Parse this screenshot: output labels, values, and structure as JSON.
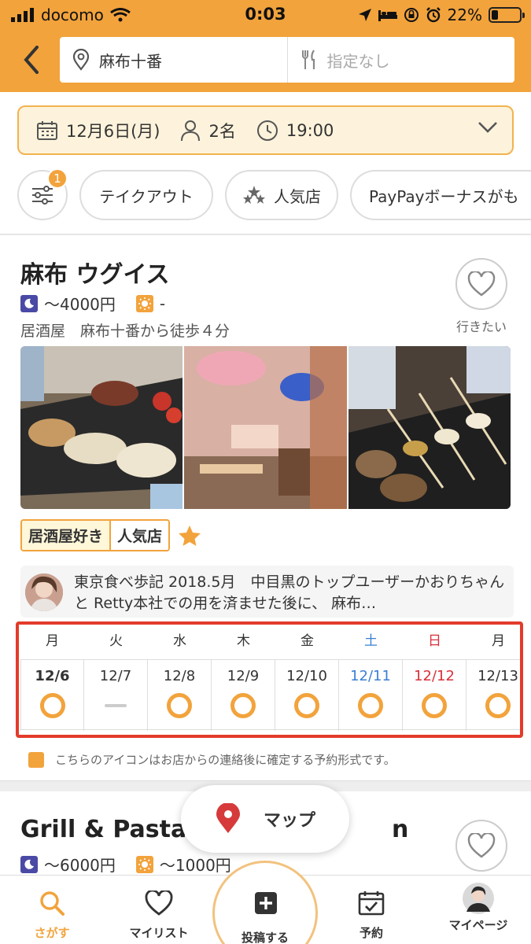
{
  "status_bar": {
    "carrier": "docomo",
    "time": "0:03",
    "battery": "22%"
  },
  "header": {
    "location": "麻布十番",
    "genre_placeholder": "指定なし"
  },
  "conditions": {
    "date": "12月6日(月)",
    "people": "2名",
    "time": "19:00"
  },
  "filter_chips": {
    "filter_badge": "1",
    "items": [
      {
        "label": "テイクアウト"
      },
      {
        "label": "人気店"
      },
      {
        "label": "PayPayボーナスがも"
      }
    ]
  },
  "restaurant1": {
    "name": "麻布 ウグイス",
    "dinner_price": "～4000円",
    "lunch_price": "-",
    "genre_access": "居酒屋　麻布十番から徒歩４分",
    "like_label": "行きたい",
    "tags": [
      "居酒屋好き",
      "人気店"
    ],
    "review": "東京食べ歩記 2018.5月　中目黒のトップユーザーかおりちゃんと Retty本社での用を済ませた後に、 麻布…"
  },
  "calendar": {
    "days": [
      {
        "dow": "月",
        "date": "12/6",
        "status": "available",
        "kind": "weekday",
        "selected": true
      },
      {
        "dow": "火",
        "date": "12/7",
        "status": "unavailable",
        "kind": "weekday"
      },
      {
        "dow": "水",
        "date": "12/8",
        "status": "available",
        "kind": "weekday"
      },
      {
        "dow": "木",
        "date": "12/9",
        "status": "available",
        "kind": "weekday"
      },
      {
        "dow": "金",
        "date": "12/10",
        "status": "available",
        "kind": "weekday"
      },
      {
        "dow": "土",
        "date": "12/11",
        "status": "available",
        "kind": "saturday"
      },
      {
        "dow": "日",
        "date": "12/12",
        "status": "available",
        "kind": "sunday"
      },
      {
        "dow": "月",
        "date": "12/13",
        "status": "available",
        "kind": "weekday"
      }
    ],
    "note": "こちらのアイコンはお店からの連絡後に確定する予約形式です。"
  },
  "restaurant2": {
    "name": "Grill & Pasta e",
    "name_tail": "n",
    "dinner_price": "～6000円",
    "lunch_price": "～1000円"
  },
  "map_button": {
    "label": "マップ"
  },
  "tabbar": {
    "search": "さがす",
    "mylist": "マイリスト",
    "post": "投稿する",
    "reserve": "予約",
    "mypage": "マイページ"
  },
  "colors": {
    "accent": "#f2a33c",
    "highlight_border": "#e33b2b",
    "saturday": "#3a7fd5",
    "sunday": "#d9303a"
  }
}
